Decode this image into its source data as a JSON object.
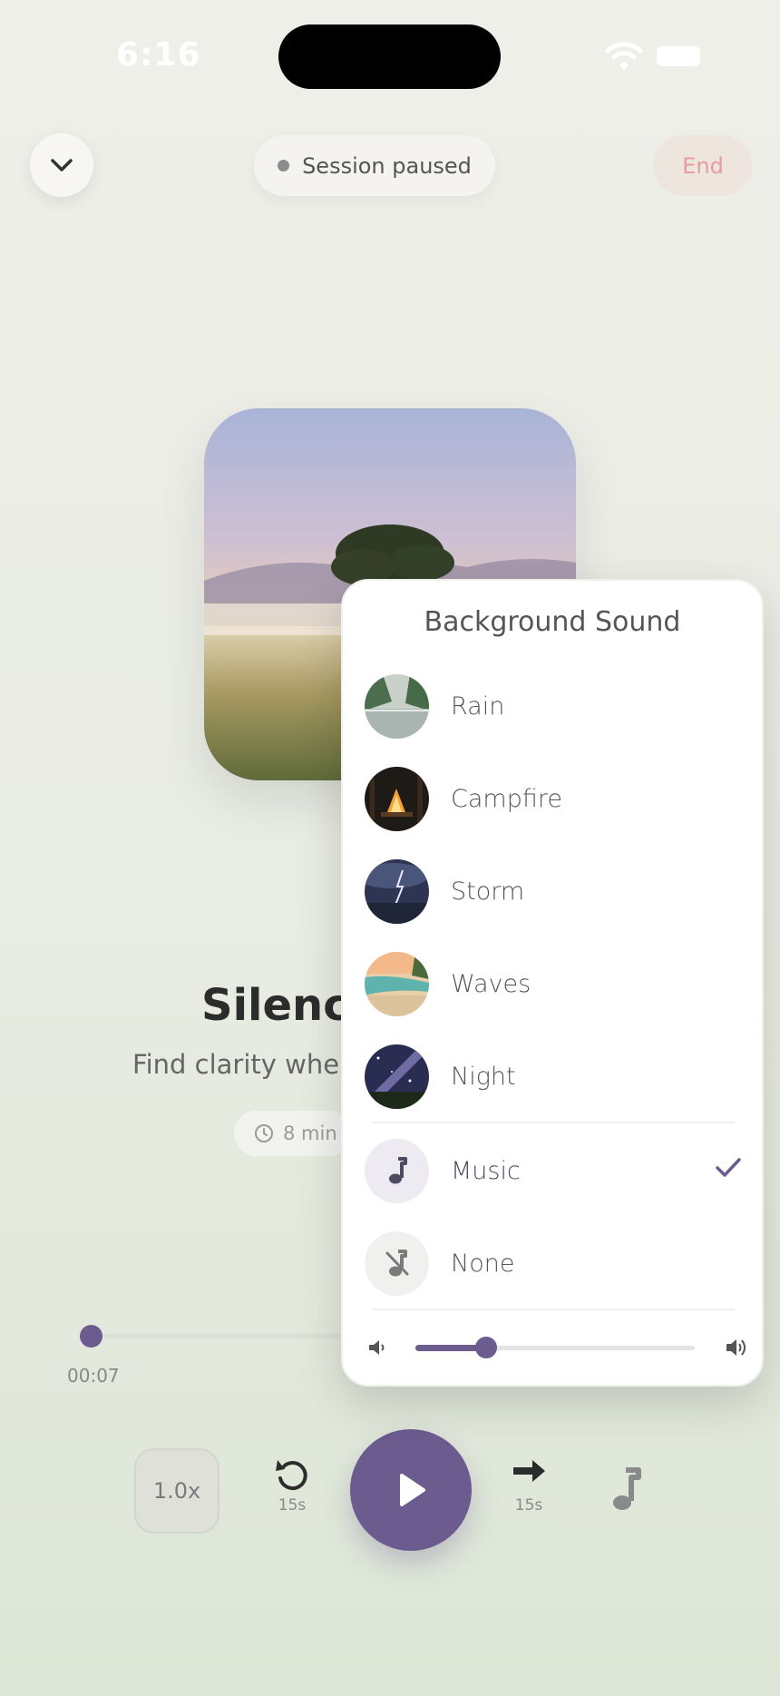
{
  "status_bar": {
    "time": "6:16"
  },
  "header": {
    "collapse_icon": "chevron-down-icon",
    "session_status": "Session paused",
    "end_label": "End"
  },
  "session": {
    "title": "Silence",
    "subtitle": "Find clarity whe",
    "duration": "8 min"
  },
  "progress": {
    "elapsed": "00:07",
    "fraction": 0.01
  },
  "controls": {
    "speed": "1.0x",
    "rewind_label": "15s",
    "forward_label": "15s",
    "play_icon": "play-icon",
    "music_icon": "music-note-icon"
  },
  "background_sound": {
    "title": "Background Sound",
    "options": [
      {
        "label": "Rain",
        "icon": "rain-thumbnail"
      },
      {
        "label": "Campfire",
        "icon": "campfire-thumbnail"
      },
      {
        "label": "Storm",
        "icon": "storm-thumbnail"
      },
      {
        "label": "Waves",
        "icon": "waves-thumbnail"
      },
      {
        "label": "Night",
        "icon": "night-thumbnail"
      },
      {
        "label": "Music",
        "icon": "music-note-icon",
        "selected": true
      },
      {
        "label": "None",
        "icon": "music-off-icon"
      }
    ],
    "volume": 0.25
  },
  "colors": {
    "accent": "#6b5b8f",
    "end_text": "#e79d9d",
    "background": "#eeefe9"
  }
}
